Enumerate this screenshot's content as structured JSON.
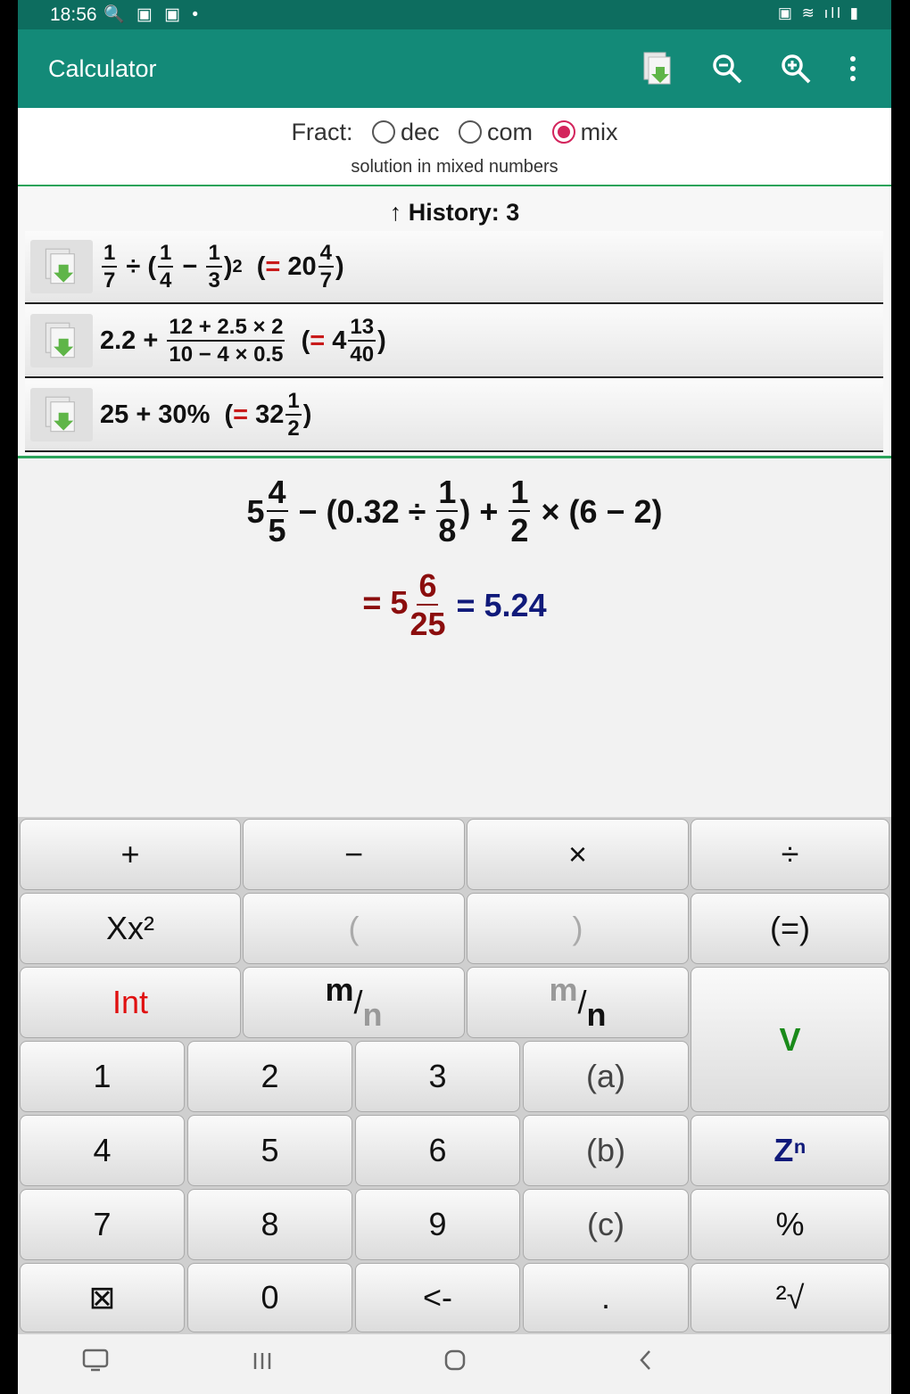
{
  "status": {
    "time": "18:56"
  },
  "appbar": {
    "title": "Calculator"
  },
  "fract": {
    "label": "Fract:",
    "options": [
      "dec",
      "com",
      "mix"
    ],
    "selected": "mix",
    "subtitle": "solution in mixed numbers"
  },
  "history": {
    "header": "↑ History: 3",
    "items": [
      {
        "text": "1/7 ÷ (1/4 − 1/3)² (= 20 4/7)"
      },
      {
        "text": "2.2 + (12 + 2.5 × 2)/(10 − 4 × 0.5) (= 4 13/40)"
      },
      {
        "text": "25 + 30% (= 32 1/2)"
      }
    ]
  },
  "main": {
    "expression": "5 4/5 − (0.32 ÷ 1/8) + 1/2 × (6 − 2)",
    "result_fraction": "= 5 6/25",
    "result_decimal": "= 5.24"
  },
  "keypad": {
    "keys": [
      "+",
      "−",
      "×",
      "÷",
      "Xx²",
      "(",
      ")",
      "(=)",
      "Int",
      "m/n",
      "m/n",
      "V",
      "1",
      "2",
      "3",
      "(a)",
      "4",
      "5",
      "6",
      "(b)",
      "Zⁿ",
      "7",
      "8",
      "9",
      "(c)",
      "%",
      "⊠",
      "0",
      "<-",
      ".",
      "²√"
    ]
  },
  "colors": {
    "appbar": "#138a78",
    "statusbar": "#0d6d5f",
    "accent_radio": "#d3245c",
    "int_key": "#e01010",
    "v_key": "#1a8a1a",
    "z_key": "#101a7a"
  }
}
